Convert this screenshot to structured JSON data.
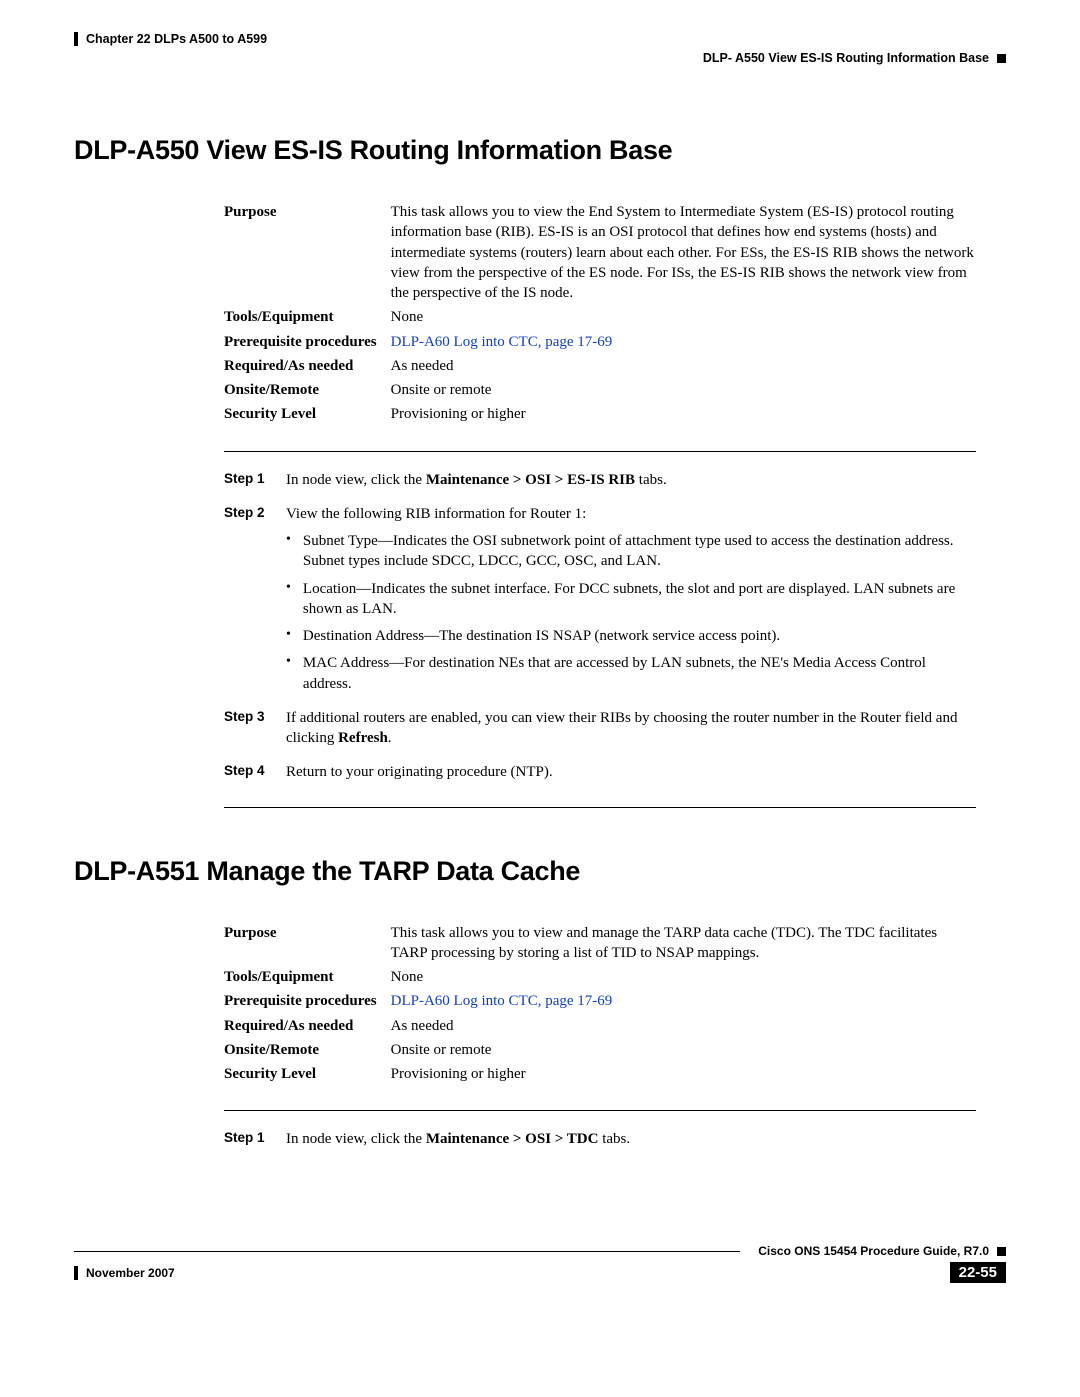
{
  "header": {
    "chapter": "Chapter 22      DLPs A500 to A599",
    "running_head": "DLP- A550 View ES-IS Routing Information Base"
  },
  "section1": {
    "title": "DLP-A550 View ES-IS Routing Information Base",
    "rows": {
      "purpose_label": "Purpose",
      "purpose_value": "This task allows you to view the End System to Intermediate System (ES-IS) protocol routing information base (RIB). ES-IS is an OSI protocol that defines how end systems (hosts) and intermediate systems (routers) learn about each other. For ESs, the ES-IS RIB shows the network view from the perspective of the ES node. For ISs, the ES-IS RIB shows the network view from the perspective of the IS node.",
      "tools_label": "Tools/Equipment",
      "tools_value": "None",
      "prereq_label": "Prerequisite procedures",
      "prereq_link": "DLP-A60 Log into CTC, page 17-69",
      "required_label": "Required/As needed",
      "required_value": "As needed",
      "onsite_label": "Onsite/Remote",
      "onsite_value": "Onsite or remote",
      "security_label": "Security Level",
      "security_value": "Provisioning or higher"
    },
    "steps": {
      "s1_label": "Step 1",
      "s1_pre": "In node view, click the ",
      "s1_bold": "Maintenance > OSI > ES-IS RIB",
      "s1_post": " tabs.",
      "s2_label": "Step 2",
      "s2_text": "View the following RIB information for Router 1:",
      "s2_b1": "Subnet Type—Indicates the OSI subnetwork point of attachment type used to access the destination address. Subnet types include SDCC, LDCC, GCC, OSC, and LAN.",
      "s2_b2": "Location—Indicates the subnet interface. For DCC subnets, the slot and port are displayed. LAN subnets are shown as LAN.",
      "s2_b3": "Destination Address—The destination IS NSAP (network service access point).",
      "s2_b4": "MAC Address—For destination NEs that are accessed by LAN subnets, the NE's Media Access Control address.",
      "s3_label": "Step 3",
      "s3_pre": "If additional routers are enabled, you can view their RIBs by choosing the router number in the Router field and clicking ",
      "s3_bold": "Refresh",
      "s3_post": ".",
      "s4_label": "Step 4",
      "s4_text": "Return to your originating procedure (NTP)."
    }
  },
  "section2": {
    "title": "DLP-A551 Manage the TARP Data Cache",
    "rows": {
      "purpose_label": "Purpose",
      "purpose_value": "This task allows you to view and manage the TARP data cache (TDC). The TDC facilitates TARP processing by storing a list of TID to NSAP mappings.",
      "tools_label": "Tools/Equipment",
      "tools_value": "None",
      "prereq_label": "Prerequisite procedures",
      "prereq_link": "DLP-A60 Log into CTC, page 17-69",
      "required_label": "Required/As needed",
      "required_value": "As needed",
      "onsite_label": "Onsite/Remote",
      "onsite_value": "Onsite or remote",
      "security_label": "Security Level",
      "security_value": "Provisioning or higher"
    },
    "steps": {
      "s1_label": "Step 1",
      "s1_pre": "In node view, click the ",
      "s1_bold": "Maintenance > OSI > TDC",
      "s1_post": " tabs."
    }
  },
  "footer": {
    "guide": "Cisco ONS 15454 Procedure Guide, R7.0",
    "date": "November 2007",
    "page": "22-55"
  }
}
